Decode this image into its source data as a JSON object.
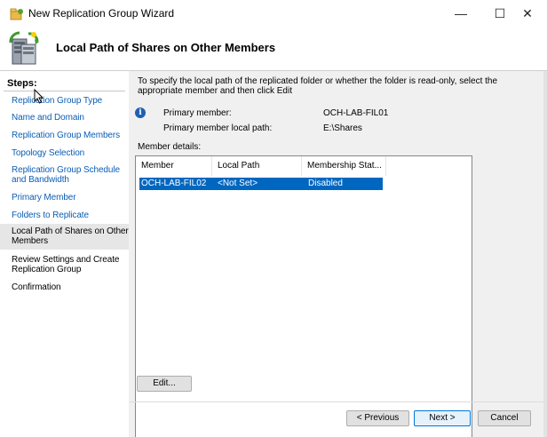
{
  "window": {
    "title": "New Replication Group Wizard",
    "minimize_glyph": "—",
    "maximize_glyph": "☐",
    "close_glyph": "✕"
  },
  "header": {
    "title": "Local Path of Shares on Other Members"
  },
  "steps": {
    "heading": "Steps:",
    "items": [
      {
        "label": "Replication Group Type",
        "state": "link"
      },
      {
        "label": "Name and Domain",
        "state": "link"
      },
      {
        "label": "Replication Group Members",
        "state": "link"
      },
      {
        "label": "Topology Selection",
        "state": "link"
      },
      {
        "label": "Replication Group Schedule and Bandwidth",
        "state": "link"
      },
      {
        "label": "Primary Member",
        "state": "link"
      },
      {
        "label": "Folders to Replicate",
        "state": "link"
      },
      {
        "label": "Local Path of Shares on Other Members",
        "state": "current"
      },
      {
        "label": "Review Settings and Create Replication Group",
        "state": "plain"
      },
      {
        "label": "Confirmation",
        "state": "plain"
      }
    ]
  },
  "main": {
    "instruction": "To specify the local path of the replicated folder or whether the folder is read-only, select the appropriate member and then click Edit",
    "primary_member_label": "Primary member:",
    "primary_member_value": "OCH-LAB-FIL01",
    "primary_path_label": "Primary member local path:",
    "primary_path_value": "E:\\Shares",
    "member_details_label": "Member details:",
    "columns": [
      "Member",
      "Local Path",
      "Membership Stat..."
    ],
    "rows": [
      {
        "member": "OCH-LAB-FIL02",
        "local_path": "<Not Set>",
        "membership_status": "Disabled",
        "selected": true
      }
    ],
    "edit_button": "Edit..."
  },
  "footer": {
    "previous_button": "< Previous",
    "next_button": "Next >",
    "cancel_button": "Cancel"
  },
  "colors": {
    "link": "#0b5eb5",
    "selection": "#0067c0",
    "current_step_bg": "#e6e6e6",
    "primary_button_border": "#0078d7"
  }
}
